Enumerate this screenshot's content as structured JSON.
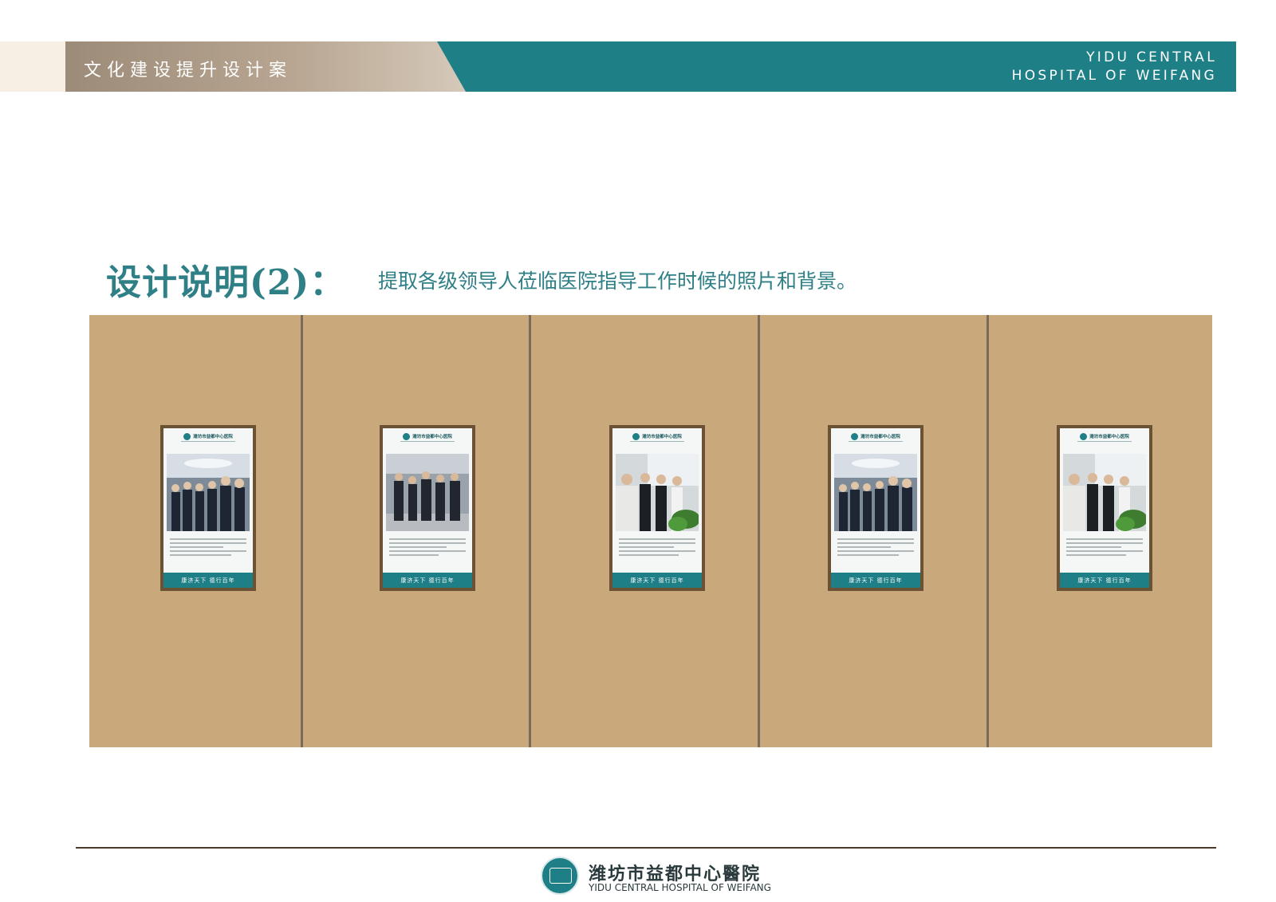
{
  "header": {
    "title": "文化建设提升设计案",
    "en_line1": "YIDU CENTRAL",
    "en_line2": "HOSPITAL OF WEIFANG"
  },
  "heading": {
    "label": "设计说明(2)：",
    "description": "提取各级领导人莅临医院指导工作时候的照片和背景。"
  },
  "panels": [
    {
      "name": "潍坊市益都中心医院",
      "slogan": "康济天下  德行百年",
      "photo": "group-meeting"
    },
    {
      "name": "潍坊市益都中心医院",
      "slogan": "康济天下  德行百年",
      "photo": "walking-group"
    },
    {
      "name": "潍坊市益都中心医院",
      "slogan": "康济天下  德行百年",
      "photo": "plant-meeting"
    },
    {
      "name": "潍坊市益都中心医院",
      "slogan": "康济天下  德行百年",
      "photo": "group-meeting"
    },
    {
      "name": "潍坊市益都中心医院",
      "slogan": "康济天下  德行百年",
      "photo": "plant-meeting"
    }
  ],
  "footer": {
    "name_cn": "潍坊市益都中心醫院",
    "name_en": "YIDU CENTRAL HOSPITAL OF WEIFANG"
  },
  "colors": {
    "teal": "#1e7f87",
    "wall": "#c9a87c",
    "frame": "#6c5234"
  }
}
